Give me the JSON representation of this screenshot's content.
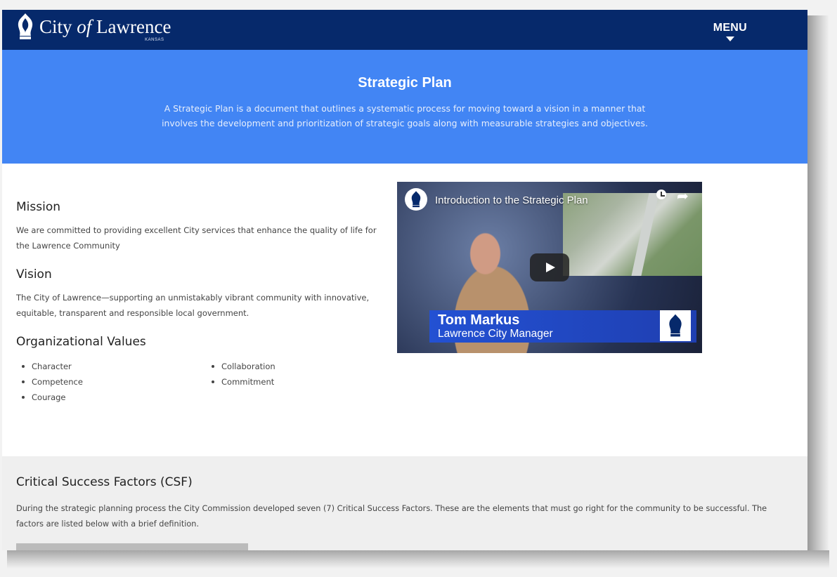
{
  "header": {
    "logo_text_1": "City ",
    "logo_text_of": "of",
    "logo_text_2": " Lawrence",
    "logo_state": "KANSAS",
    "menu_label": "MENU"
  },
  "hero": {
    "title": "Strategic Plan",
    "description": "A Strategic Plan is a document that outlines a systematic process for moving toward a vision in a manner that involves the development and prioritization of strategic goals along with measurable strategies and objectives."
  },
  "mission": {
    "heading": "Mission",
    "text": "We are committed to providing excellent City services that enhance the quality of life for the Lawrence Community"
  },
  "vision": {
    "heading": "Vision",
    "text": "The City of Lawrence—supporting an unmistakably vibrant community with innovative, equitable, transparent and responsible local government."
  },
  "values": {
    "heading": "Organizational Values",
    "col1": [
      "Character",
      "Competence",
      "Courage"
    ],
    "col2": [
      "Collaboration",
      "Commitment"
    ]
  },
  "video": {
    "title": "Introduction to the Strategic Plan",
    "name": "Tom Markus",
    "role": "Lawrence City Manager"
  },
  "csf": {
    "heading": "Critical Success Factors (CSF)",
    "text": "During the strategic planning process the City Commission developed seven (7) Critical Success Factors. These are the elements that must go right for the community to be successful. The factors are listed below with a brief definition."
  },
  "colors": {
    "header_bg": "#06296b",
    "hero_bg": "#4285f4",
    "csf_bg": "#efefef"
  }
}
